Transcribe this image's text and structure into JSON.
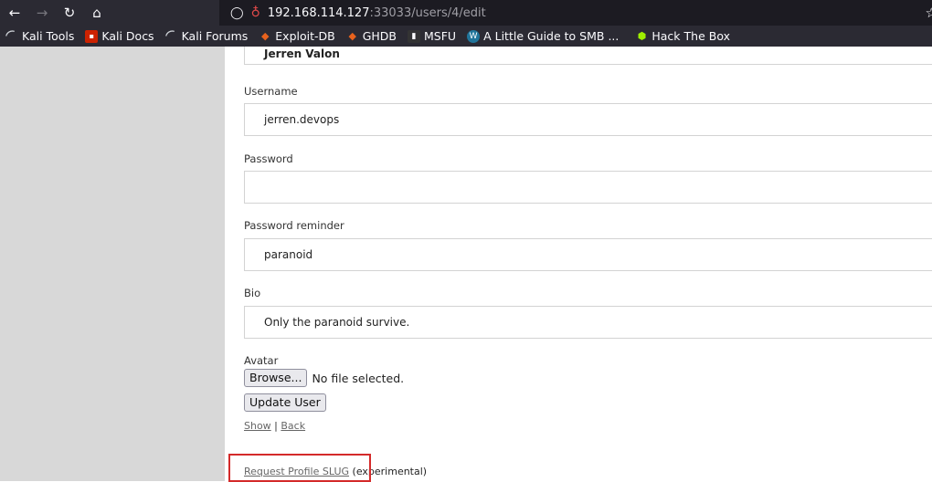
{
  "browser": {
    "url_host": "192.168.114.127",
    "url_path": ":33033/users/4/edit",
    "icons": [
      "back-arrow-icon",
      "forward-arrow-icon",
      "reload-icon",
      "home-icon",
      "shield-icon",
      "lock-warning-icon",
      "bookmark-star-icon"
    ]
  },
  "bookmarks": [
    {
      "label": "Kali Tools",
      "icon": "kali-dragon-icon"
    },
    {
      "label": "Kali Docs",
      "icon": "kali-docs-icon"
    },
    {
      "label": "Kali Forums",
      "icon": "kali-dragon-icon"
    },
    {
      "label": "Exploit-DB",
      "icon": "exploit-db-icon"
    },
    {
      "label": "GHDB",
      "icon": "ghdb-icon"
    },
    {
      "label": "MSFU",
      "icon": "msfu-icon"
    },
    {
      "label": "A Little Guide to SMB ...",
      "icon": "wordpress-icon"
    },
    {
      "label": "Hack The Box",
      "icon": "htb-cube-icon"
    }
  ],
  "form": {
    "name_value": "Jerren Valon",
    "username_label": "Username",
    "username_value": "jerren.devops",
    "password_label": "Password",
    "password_value": "",
    "reminder_label": "Password reminder",
    "reminder_value": "paranoid",
    "bio_label": "Bio",
    "bio_value": "Only the paranoid survive.",
    "avatar_label": "Avatar",
    "browse_label": "Browse...",
    "no_file_text": "No file selected.",
    "submit_label": "Update User"
  },
  "links": {
    "show": "Show",
    "separator": " | ",
    "back": "Back",
    "slug_link": "Request Profile SLUG",
    "slug_note": " (experimental)"
  },
  "colors": {
    "chrome_bg": "#2b2a33",
    "sidebar_bg": "#d8d8d8",
    "highlight_border": "#d42a2a"
  }
}
